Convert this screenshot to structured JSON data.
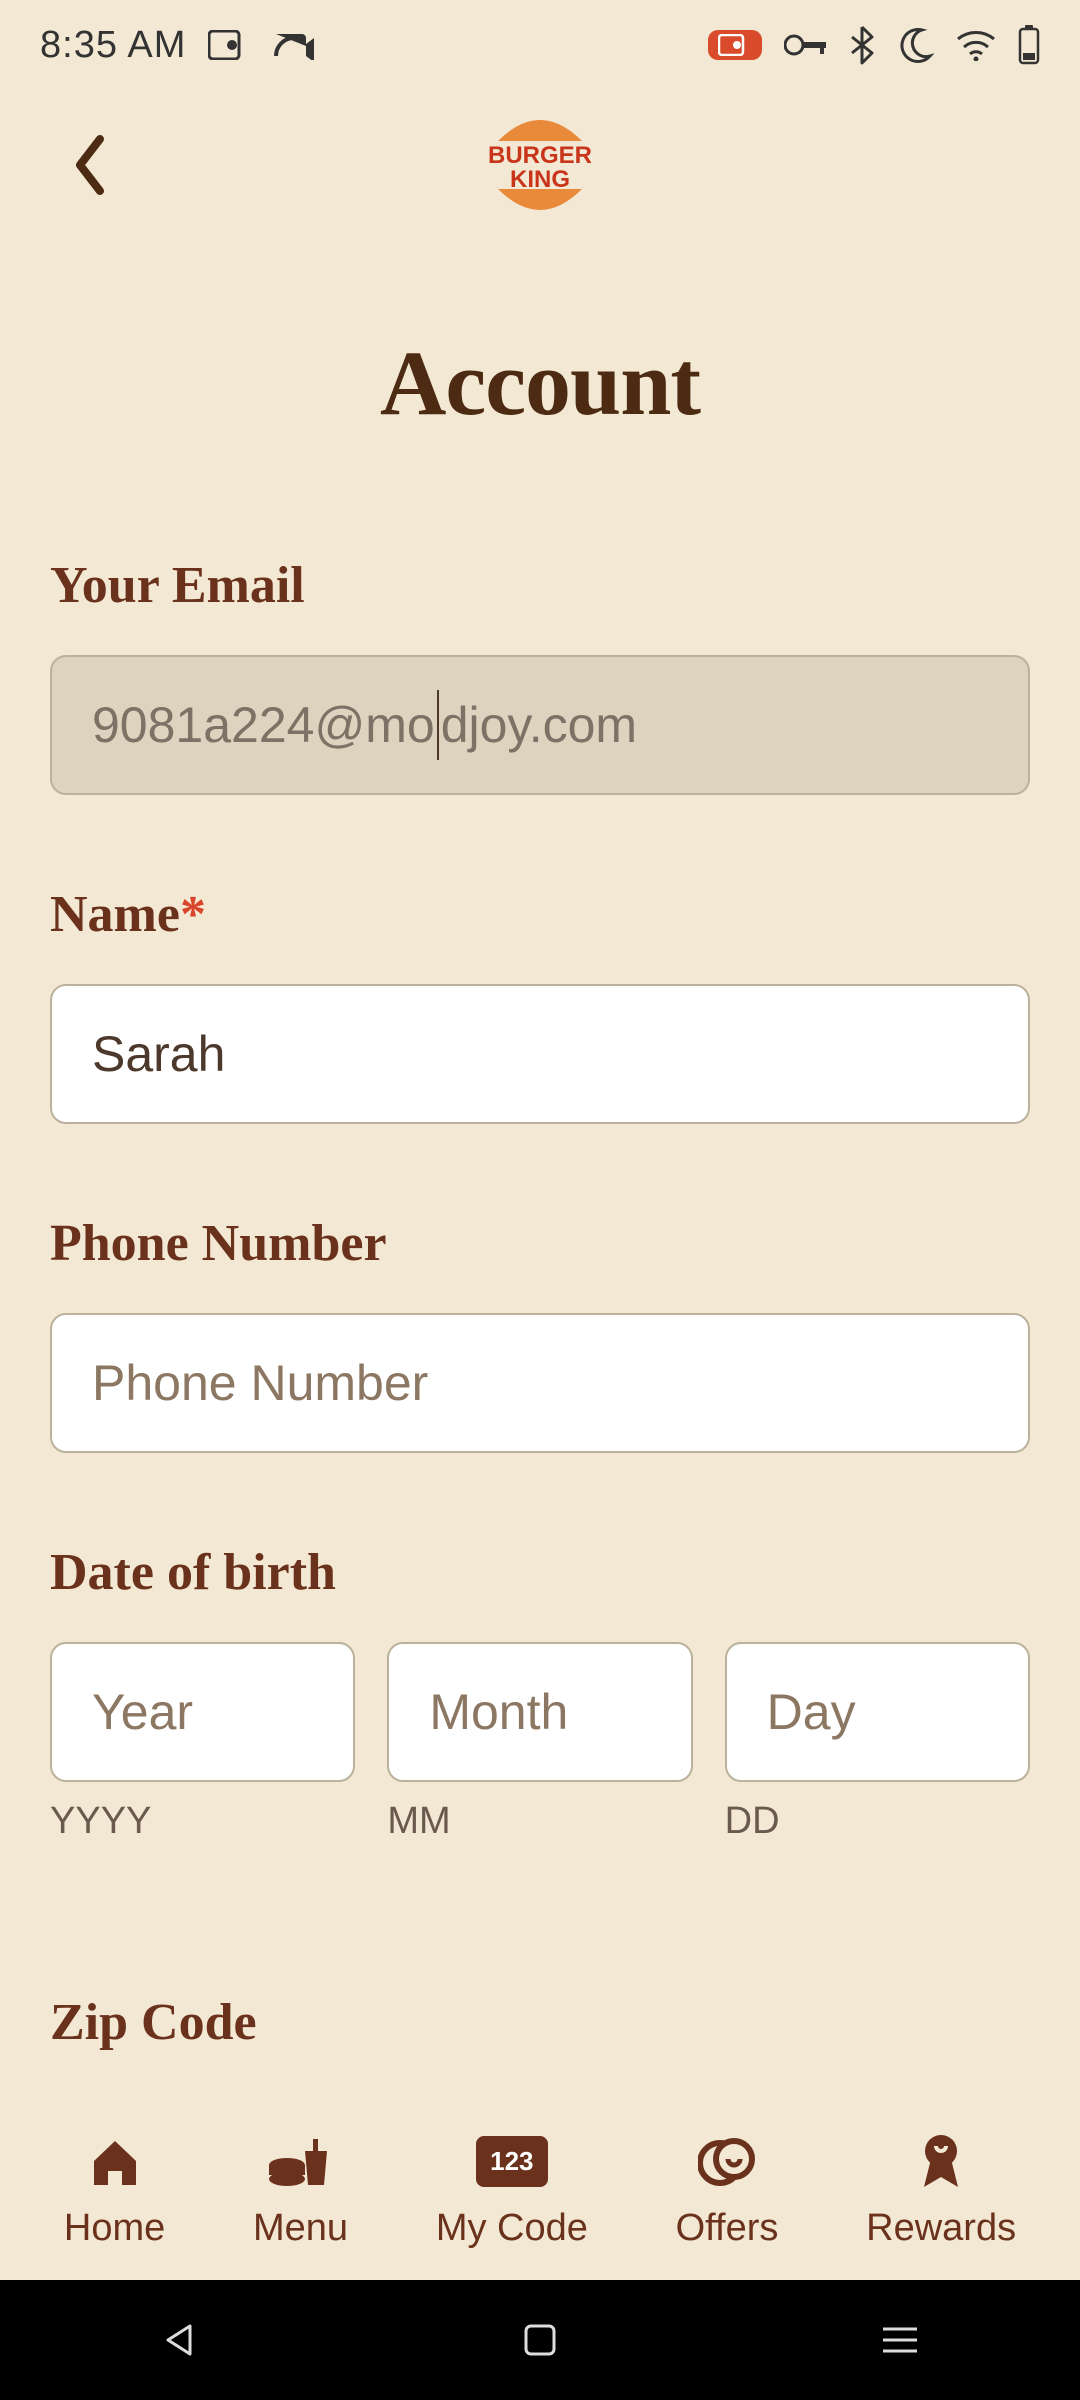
{
  "status": {
    "time": "8:35 AM"
  },
  "header": {
    "logo_top": "BURGER",
    "logo_bottom": "KING"
  },
  "page": {
    "title": "Account"
  },
  "fields": {
    "email": {
      "label": "Your Email",
      "value_pre": "9081a224@mo",
      "value_post": "djoy.com"
    },
    "name": {
      "label": "Name",
      "required": "*",
      "value": "Sarah"
    },
    "phone": {
      "label": "Phone Number",
      "placeholder": "Phone Number"
    },
    "dob": {
      "label": "Date of birth",
      "year": {
        "placeholder": "Year",
        "hint": "YYYY"
      },
      "month": {
        "placeholder": "Month",
        "hint": "MM"
      },
      "day": {
        "placeholder": "Day",
        "hint": "DD"
      }
    },
    "zip": {
      "label": "Zip Code"
    }
  },
  "nav": {
    "home": "Home",
    "menu": "Menu",
    "mycode": "My Code",
    "mycode_badge": "123",
    "offers": "Offers",
    "rewards": "Rewards"
  }
}
